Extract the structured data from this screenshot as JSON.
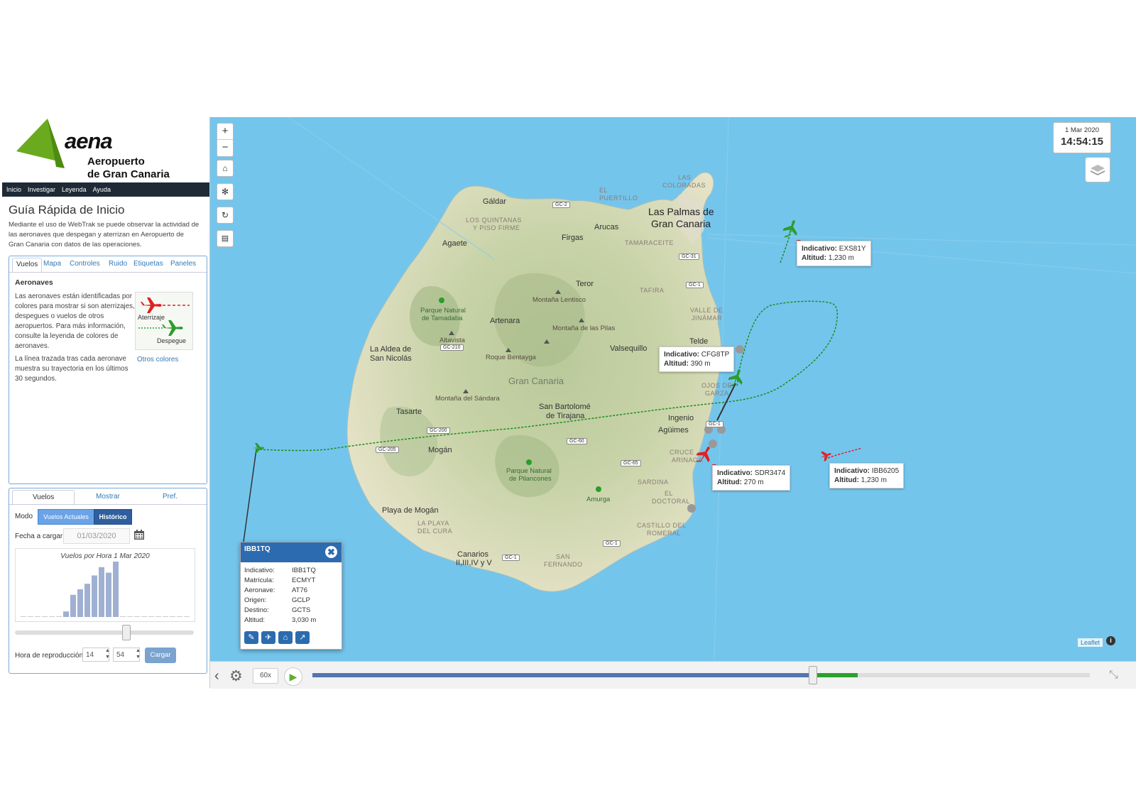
{
  "brand": {
    "logo": "aena",
    "line1": "Aeropuerto",
    "line2": "de Gran Canaria",
    "accent": "#6aaa1e"
  },
  "nav": [
    "Inicio",
    "Investigar",
    "Leyenda",
    "Ayuda"
  ],
  "guide": {
    "title": "Guía Rápida de Inicio",
    "text": "Mediante el uso de WebTrak se puede observar la actividad de las aeronaves que despegan y aterrizan en Aeropuerto de Gran Canaria con datos de las operaciones."
  },
  "panel1": {
    "tabs": [
      "Vuelos",
      "Mapa",
      "Controles",
      "Ruido",
      "Etiquetas",
      "Paneles"
    ],
    "section_title": "Aeronaves",
    "text1": "Las aeronaves están identificadas por colores para mostrar si son aterrizajes, despegues o vuelos de otros aeropuertos. Para más información, consulte la leyenda de colores de aeronaves.",
    "text2": "La línea trazada tras cada aeronave muestra su trayectoria en los últimos 30 segundos.",
    "legend_landing": "Aterrizaje",
    "legend_takeoff": "Despegue",
    "other_colors": "Otros colores",
    "landing_color": "#e02020",
    "takeoff_color": "#2a9d2a"
  },
  "panel2": {
    "tabs": [
      "Vuelos",
      "Mostrar",
      "Pref."
    ],
    "mode_label": "Modo",
    "mode_live": "Vuelos Actuales",
    "mode_hist": "Histórico",
    "date_label": "Fecha a cargar",
    "date_value": "01/03/2020",
    "histogram_title": "Vuelos por Hora 1 Mar 2020",
    "histogram_values": [
      0,
      0,
      0,
      0,
      0,
      0,
      2,
      8,
      10,
      12,
      15,
      18,
      16,
      20,
      0,
      0,
      0,
      0,
      0,
      0,
      0,
      0,
      0,
      0
    ],
    "playback_position": 0.62,
    "hour_label": "Hora de reproducción",
    "hour": "14",
    "minute": "54",
    "load_button": "Cargar"
  },
  "map": {
    "date": "1 Mar 2020",
    "time": "14:54:15",
    "controls": [
      "zoom-in",
      "zoom-out",
      "home",
      "group",
      "refresh",
      "print"
    ],
    "zoom_in": "+",
    "zoom_out": "−",
    "labels": {
      "galdar": "Gáldar",
      "las_palmas_1": "Las Palmas de",
      "las_palmas_2": "Gran Canaria",
      "agaete": "Agaete",
      "firgas": "Firgas",
      "arucas": "Arucas",
      "teror": "Teror",
      "telde": "Telde",
      "artenara": "Artenara",
      "valsequillo": "Valsequillo",
      "aldea_1": "La Aldea de",
      "aldea_2": "San Nicolás",
      "gran_canaria": "Gran Canaria",
      "sbt_1": "San Bartolomé",
      "sbt_2": "de Tirajana",
      "ingenio": "Ingenio",
      "aguimes": "Agüimes",
      "tasarte": "Tasarte",
      "mogan": "Mogán",
      "playa_mogan": "Playa de Mogán",
      "amurga": "Amurga",
      "canarios_1": "Canarios",
      "canarios_2": "II,III,IV y V",
      "san_fernando_1": "SAN",
      "san_fernando_2": "FERNANDO",
      "isleta_1": "LAS",
      "isleta_2": "COLORADAS",
      "el_puertillo_1": "EL",
      "el_puertillo_2": "PUERTILLO",
      "quintanas_1": "LOS QUINTANAS",
      "quintanas_2": "Y PISO FIRME",
      "tamaraceite": "TAMARACEITE",
      "tafira": "TAFIRA",
      "valle_1": "VALLE DE",
      "valle_2": "JINÁMAR",
      "ojos_1": "OJOS DE",
      "ojos_2": "GARZA",
      "cruce_1": "CRUCE",
      "cruce_2": "ARINAGA",
      "sardina": "SARDINA",
      "doctoral_1": "EL",
      "doctoral_2": "DOCTORAL",
      "castillo_1": "CASTILLO DEL",
      "castillo_2": "ROMERAL",
      "playa_cura_1": "LA PLAYA",
      "playa_cura_2": "DEL CURA",
      "tamadaba_1": "Parque Natural",
      "tamadaba_2": "de Tamadaba",
      "pilancones_1": "Parque Natural",
      "pilancones_2": "de Pilancones",
      "altavista": "Altavista",
      "lentisco": "Montaña Lentisco",
      "pilas": "Montaña de las Pilas",
      "bentayga": "Roque Bentayga",
      "sandara": "Montaña del Sándara"
    },
    "roads": {
      "gc2": "GC-2",
      "gc31": "GC-31",
      "gc1a": "GC-1",
      "gc210": "GC-210",
      "gc200": "GC-200",
      "gc205": "GC-205",
      "gc60": "GC-60",
      "gc65": "GC-65",
      "gc1b": "GC-1",
      "gc1c": "GC-1",
      "gc1d": "GC-1"
    },
    "flights": [
      {
        "callsign_label": "Indicativo:",
        "callsign": "EXS81Y",
        "alt_label": "Altitud:",
        "altitude": "1,230 m"
      },
      {
        "callsign_label": "Indicativo:",
        "callsign": "CFG8TP",
        "alt_label": "Altitud:",
        "altitude": "390 m"
      },
      {
        "callsign_label": "Indicativo:",
        "callsign": "SDR3474",
        "alt_label": "Altitud:",
        "altitude": "270 m"
      },
      {
        "callsign_label": "Indicativo:",
        "callsign": "IBB6205",
        "alt_label": "Altitud:",
        "altitude": "1,230 m"
      }
    ],
    "popup": {
      "title": "IBB1TQ",
      "rows": [
        {
          "k": "Indicativo:",
          "v": "IBB1TQ"
        },
        {
          "k": "Matrícula:",
          "v": "ECMYT"
        },
        {
          "k": "Aeronave:",
          "v": "AT76"
        },
        {
          "k": "Origen:",
          "v": "GCLP"
        },
        {
          "k": "Destino:",
          "v": "GCTS"
        },
        {
          "k": "Altitud:",
          "v": "3,030 m"
        }
      ],
      "icons": [
        "comment-icon",
        "plane-icon",
        "home-icon",
        "chart-icon"
      ]
    },
    "attribution": "Leaflet"
  },
  "playbar": {
    "speed": "60x",
    "progress": 0.643
  }
}
